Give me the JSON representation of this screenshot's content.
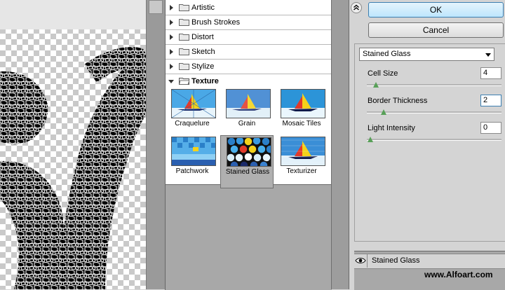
{
  "gallery": {
    "categories": [
      {
        "label": "Artistic"
      },
      {
        "label": "Brush Strokes"
      },
      {
        "label": "Distort"
      },
      {
        "label": "Sketch"
      },
      {
        "label": "Stylize"
      },
      {
        "label": "Texture"
      }
    ],
    "thumbnails": [
      {
        "label": "Craquelure"
      },
      {
        "label": "Grain"
      },
      {
        "label": "Mosaic Tiles"
      },
      {
        "label": "Patchwork"
      },
      {
        "label": "Stained Glass"
      },
      {
        "label": "Texturizer"
      }
    ]
  },
  "buttons": {
    "ok": "OK",
    "cancel": "Cancel"
  },
  "settings": {
    "selected_filter": "Stained Glass",
    "params": [
      {
        "label": "Cell Size",
        "value": "4",
        "level": 0.04
      },
      {
        "label": "Border Thickness",
        "value": "2",
        "level": 0.1
      },
      {
        "label": "Light Intensity",
        "value": "0",
        "level": 0.0
      }
    ]
  },
  "layers": {
    "active": "Stained Glass"
  },
  "watermark": "www.Alfoart.com",
  "colors": {
    "ok_border": "#3c7fb1",
    "slider_thumb": "#58a058",
    "gallery_bg": "#ffffff"
  }
}
